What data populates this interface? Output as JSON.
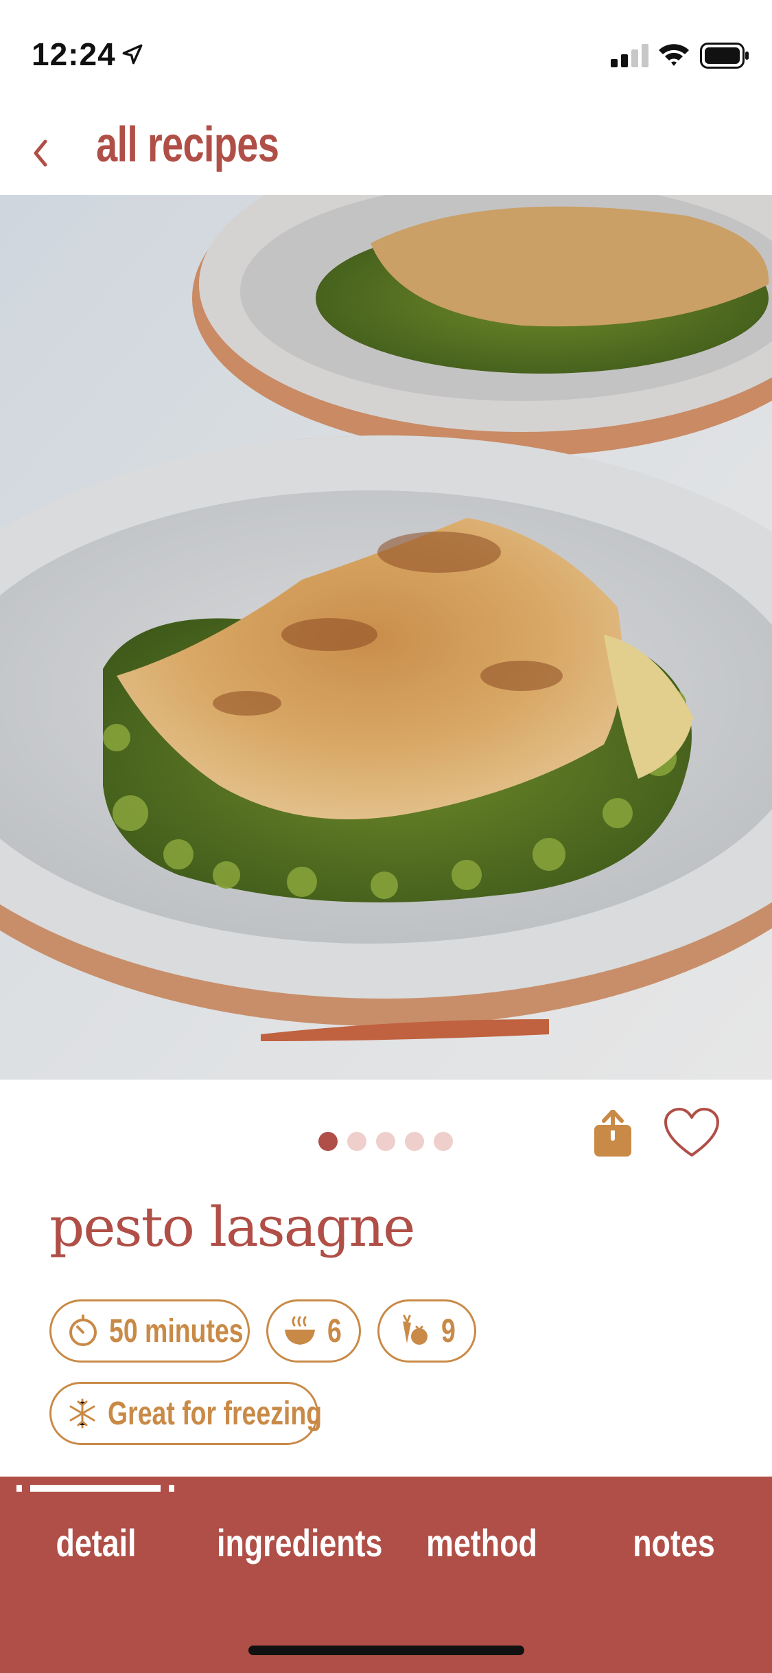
{
  "status_bar": {
    "time": "12:24"
  },
  "nav": {
    "back_label": "all recipes"
  },
  "carousel": {
    "total": 5,
    "active_index": 1
  },
  "recipe": {
    "title": "pesto lasagne",
    "time": "50 minutes",
    "servings": "6",
    "veg_count": "9",
    "freezer": "Great for freezing"
  },
  "tabs": {
    "detail": "detail",
    "ingredients": "ingredients",
    "method": "method",
    "notes": "notes"
  },
  "colors": {
    "brand": "#b04f47",
    "accent": "#c98a47",
    "dot_inactive": "#efcfcb"
  },
  "icons": {
    "back": "chevron-left-icon",
    "share": "share-icon",
    "favorite": "heart-icon",
    "time": "timer-icon",
    "servings": "bowl-icon",
    "veg": "carrot-tomato-icon",
    "freezer": "snowflake-icon"
  }
}
